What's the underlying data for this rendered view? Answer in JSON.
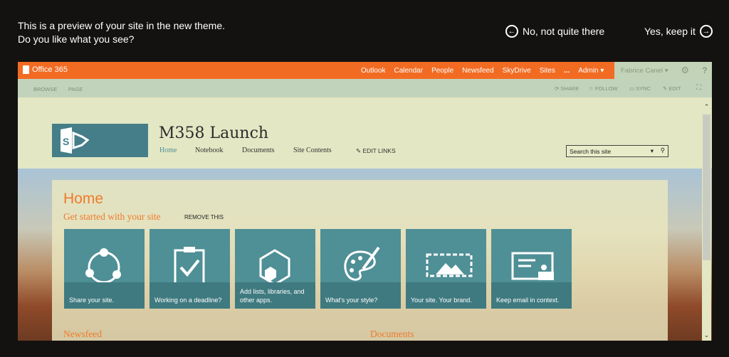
{
  "preview": {
    "line1": "This is a preview of your site in the new theme.",
    "line2": "Do you like what you see?",
    "reject": "No, not quite there",
    "accept": "Yes, keep it"
  },
  "suite": {
    "brand": "Office 365",
    "nav": [
      "Outlook",
      "Calendar",
      "People",
      "Newsfeed",
      "SkyDrive",
      "Sites",
      "...",
      "Admin ▾"
    ],
    "user": "Fabrice Canel ▾"
  },
  "ribbon": {
    "tabs": [
      "BROWSE",
      "PAGE"
    ],
    "actions": [
      "SHARE",
      "FOLLOW",
      "SYNC",
      "EDIT"
    ]
  },
  "site": {
    "title": "M358 Launch",
    "nav": [
      "Home",
      "Notebook",
      "Documents",
      "Site Contents"
    ],
    "edit_links": "EDIT LINKS",
    "search_placeholder": "Search this site"
  },
  "page": {
    "heading": "Home",
    "subheading": "Get started with your site",
    "remove": "REMOVE THIS",
    "tiles": [
      {
        "label": "Share your site.",
        "icon": "share-icon"
      },
      {
        "label": "Working on a deadline?",
        "icon": "clipboard-check-icon"
      },
      {
        "label": "Add lists, libraries, and other apps.",
        "icon": "hexagon-apps-icon"
      },
      {
        "label": "What's your style?",
        "icon": "palette-icon"
      },
      {
        "label": "Your site. Your brand.",
        "icon": "image-icon"
      },
      {
        "label": "Keep email in context.",
        "icon": "email-contacts-icon"
      }
    ],
    "newsfeed": "Newsfeed",
    "documents": "Documents"
  },
  "colors": {
    "suite": "#f26b22",
    "tile": "#4f8f96",
    "accent": "#f07a2a"
  }
}
